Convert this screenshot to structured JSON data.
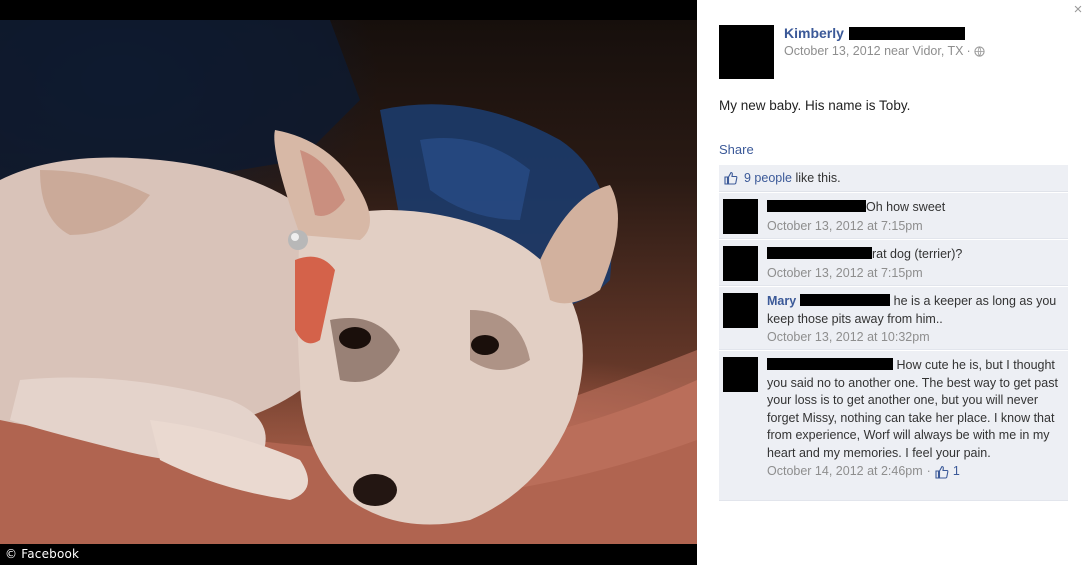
{
  "photo": {
    "watermark": "© Facebook"
  },
  "close": {
    "glyph": "×"
  },
  "post": {
    "author_name": "Kimberly",
    "date_location": "October 13, 2012 near Vidor, TX",
    "separator": "·",
    "text": "My new baby. His name is Toby.",
    "share_label": "Share"
  },
  "likes": {
    "link_text": "9 people",
    "suffix": " like this."
  },
  "comments": [
    {
      "name": "",
      "text": "Oh how sweet",
      "time": "October 13, 2012 at 7:15pm"
    },
    {
      "name": "",
      "text": "rat dog (terrier)?",
      "time": "October 13, 2012 at 7:15pm"
    },
    {
      "name": "Mary",
      "text": " he is a keeper as long as you keep those pits away from him..",
      "time": "October 13, 2012 at 10:32pm"
    },
    {
      "name": "",
      "text": " How cute he is, but I thought you said no to another one. The best way to get past your loss is to get another one, but you will never forget Missy, nothing can take her place. I know that from experience, Worf will always be with me in my heart and my memories. I feel your pain.",
      "time": "October 14, 2012 at 2:46pm",
      "separator": "·",
      "like_count": "1"
    }
  ],
  "icons": {
    "close": "close-icon",
    "globe": "globe-icon",
    "like": "thumbs-up-icon"
  },
  "colors": {
    "link": "#3b5998",
    "ufi_background": "#edeff4",
    "meta_text": "#8e8e8e"
  }
}
